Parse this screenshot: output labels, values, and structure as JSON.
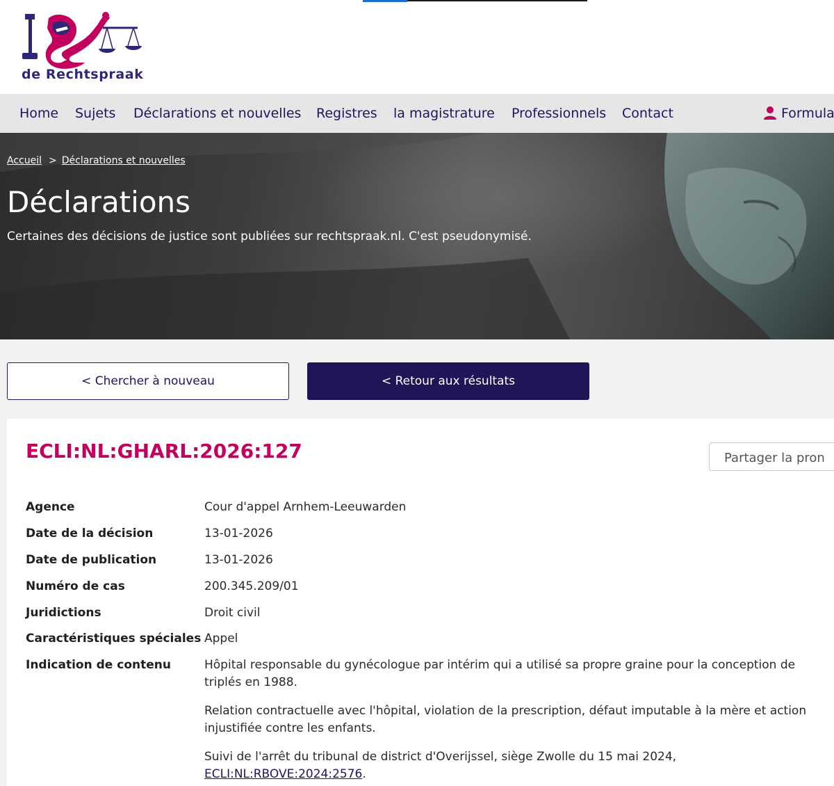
{
  "header": {
    "logo_text": "de Rechtspraak"
  },
  "nav": {
    "items": [
      "Home",
      "Sujets",
      "Déclarations et nouvelles",
      "Registres",
      "la magistrature",
      "Professionnels",
      "Contact"
    ],
    "user_label": "Formula",
    "colors": {
      "text": "#1c1660",
      "background": "#e6e6e6",
      "user_icon": "#c4005e"
    }
  },
  "hero": {
    "breadcrumb": {
      "home": "Accueil",
      "separator": ">",
      "current": "Déclarations et nouvelles"
    },
    "title": "Déclarations",
    "subtitle": "Certaines des décisions de justice sont publiées sur rechtspraak.nl. C'est pseudonymisé."
  },
  "actions": {
    "search_again": "< Chercher à nouveau",
    "back_to_results": "< Retour aux résultats"
  },
  "decision": {
    "ecli": "ECLI:NL:GHARL:2026:127",
    "share_label": "Partager la pron",
    "fields": [
      {
        "label": "Agence",
        "value": "Cour d'appel Arnhem-Leeuwarden"
      },
      {
        "label": "Date de la décision",
        "value": "13-01-2026"
      },
      {
        "label": "Date de publication",
        "value": "13-01-2026"
      },
      {
        "label": "Numéro de cas",
        "value": "200.345.209/01"
      },
      {
        "label": "Juridictions",
        "value": "Droit civil"
      },
      {
        "label": "Caractéristiques spéciales",
        "value": "Appel"
      }
    ],
    "content_label": "Indication de contenu",
    "content_paragraphs": [
      "Hôpital responsable du gynécologue par intérim qui a utilisé sa propre graine pour la conception de triplés en 1988.",
      "Relation contractuelle avec l'hôpital, violation de la prescription, défaut imputable à la mère et action injustifiée contre les enfants."
    ],
    "reference_text": "Suivi de l'arrêt du tribunal de district d'Overijssel, siège Zwolle du 15 mai 2024,",
    "reference_link": "ECLI:NL:RBOVE:2024:2576",
    "reference_end": ".",
    "colors": {
      "ecli": "#c4005e",
      "primary_button": "#1e1656"
    }
  }
}
